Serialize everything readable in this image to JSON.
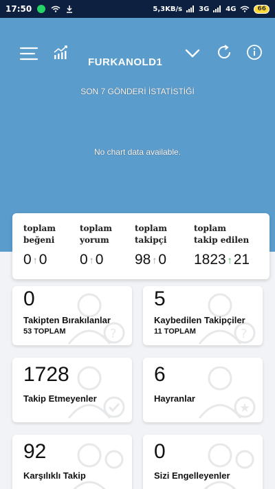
{
  "status_bar": {
    "time": "17:50",
    "network_speed": "5,3KB/s",
    "net1": "3G",
    "net2": "4G",
    "battery": "66"
  },
  "toolbar": {
    "username": "FURKANOLD1"
  },
  "chart": {
    "title": "SON 7 GÖNDERİ İSTATİSTİĞİ",
    "empty_message": "No chart data available."
  },
  "summary": [
    {
      "label": "toplam\nbeğeni",
      "value": "0",
      "delta": "0"
    },
    {
      "label": "toplam\nyorum",
      "value": "0",
      "delta": "0"
    },
    {
      "label": "toplam\ntakipçi",
      "value": "98",
      "delta": "0"
    },
    {
      "label": "toplam\ntakip edilen",
      "value": "1823",
      "delta": "21"
    }
  ],
  "cards": [
    {
      "number": "0",
      "title": "Takipten Bırakılanlar",
      "subtitle": "53 TOPLAM"
    },
    {
      "number": "5",
      "title": "Kaybedilen Takipçiler",
      "subtitle": "11 TOPLAM"
    },
    {
      "number": "1728",
      "title": "Takip Etmeyenler",
      "subtitle": ""
    },
    {
      "number": "6",
      "title": "Hayranlar",
      "subtitle": ""
    },
    {
      "number": "92",
      "title": "Karşılıklı Takip",
      "subtitle": ""
    },
    {
      "number": "0",
      "title": "Sizi Engelleyenler",
      "subtitle": ""
    }
  ],
  "colors": {
    "header_blue": "#5a9ccc",
    "status_bar": "#0d2040",
    "delta_up_green": "#2aa84a"
  },
  "icons": {
    "menu": "hamburger-icon",
    "stats": "chart-icon",
    "dropdown": "chevron-down-icon",
    "refresh": "refresh-icon",
    "info": "info-icon"
  }
}
